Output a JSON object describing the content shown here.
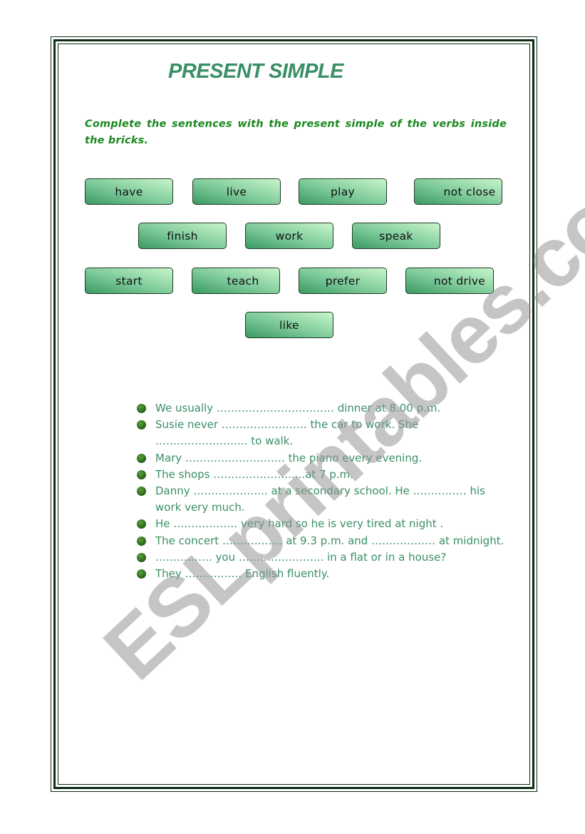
{
  "worksheet": {
    "title": "PRESENT SIMPLE",
    "instructions": "Complete the sentences with the present simple of the verbs inside the bricks.",
    "bricks": [
      {
        "label": "have"
      },
      {
        "label": "live"
      },
      {
        "label": "play"
      },
      {
        "label": "not close"
      },
      {
        "label": "finish"
      },
      {
        "label": "work"
      },
      {
        "label": "speak"
      },
      {
        "label": "start"
      },
      {
        "label": "teach"
      },
      {
        "label": "prefer"
      },
      {
        "label": "not drive"
      },
      {
        "label": "like"
      }
    ],
    "sentences": [
      "We usually …………………………… dinner at 8.00 p.m.",
      "Susie never …………………… the car to work. She …………………….. to walk.",
      "Mary ………………………. the piano every evening.",
      "The shops ………………….....at 7 p.m.",
      "Danny ………………... at a secondary school. He …………… his work very much.",
      "He ……………… very hard so he is very tired at night .",
      "The concert ………..…… at 9.3 p.m. and ……………… at midnight.",
      "……………. you …………………... in a flat or in a house?",
      "They ……………. English fluently."
    ]
  },
  "watermark": {
    "text": "ESLprintables.com"
  },
  "colors": {
    "title": "#3a8f66",
    "instructions": "#1a8a1f",
    "sentence_text": "#3a8f66",
    "brick_dark": "#3a9a62",
    "brick_light": "#c9f6cb",
    "border": "#0d2a12"
  }
}
